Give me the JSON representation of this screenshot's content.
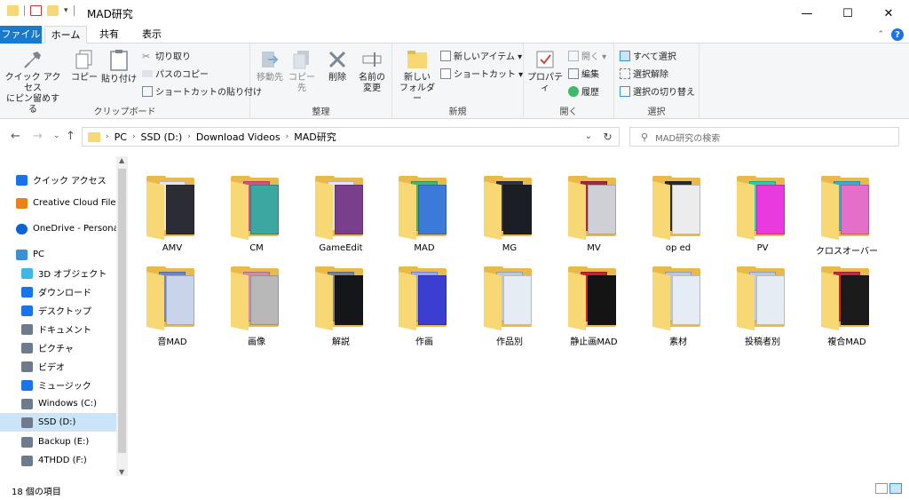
{
  "window": {
    "title": "MAD研究",
    "minimize": "—",
    "maximize": "☐",
    "close": "✕"
  },
  "ribbon_tabs": {
    "file": "ファイル",
    "home": "ホーム",
    "share": "共有",
    "view": "表示"
  },
  "ribbon": {
    "clipboard": {
      "label": "クリップボード",
      "pin": "クイック アクセス\nにピン留めする",
      "copy": "コピー",
      "paste": "貼り付け",
      "cut": "切り取り",
      "copy_path": "パスのコピー",
      "paste_shortcut": "ショートカットの貼り付け"
    },
    "organize": {
      "label": "整理",
      "move_to": "移動先",
      "copy_to": "コピー先",
      "delete": "削除",
      "rename": "名前の\n変更"
    },
    "new": {
      "label": "新規",
      "new_folder": "新しい\nフォルダー",
      "new_item": "新しいアイテム ▾",
      "shortcut": "ショートカット ▾"
    },
    "open": {
      "label": "開く",
      "properties": "プロパティ",
      "open": "開く ▾",
      "edit": "編集",
      "history": "履歴"
    },
    "select": {
      "label": "選択",
      "select_all": "すべて選択",
      "select_none": "選択解除",
      "invert": "選択の切り替え"
    }
  },
  "address": {
    "crumbs": [
      "PC",
      "SSD (D:)",
      "Download Videos",
      "MAD研究"
    ],
    "search_placeholder": "MAD研究の検索"
  },
  "nav": {
    "items": [
      {
        "label": "クイック アクセス",
        "icon": "star-icon",
        "color": "#1a73e8"
      },
      {
        "label": "Creative Cloud Files",
        "icon": "creative-cloud-icon",
        "color": "#e8831a"
      },
      {
        "label": "OneDrive - Persona",
        "icon": "cloud-icon",
        "color": "#0a64d1"
      },
      {
        "label": "PC",
        "icon": "pc-icon",
        "color": "#3d8fd6"
      },
      {
        "label": "3D オブジェクト",
        "icon": "cube-icon",
        "color": "#3fb6e8"
      },
      {
        "label": "ダウンロード",
        "icon": "download-icon",
        "color": "#1a73e8"
      },
      {
        "label": "デスクトップ",
        "icon": "desktop-icon",
        "color": "#1a73e8"
      },
      {
        "label": "ドキュメント",
        "icon": "document-icon",
        "color": "#6d7b8d"
      },
      {
        "label": "ピクチャ",
        "icon": "picture-icon",
        "color": "#6d7b8d"
      },
      {
        "label": "ビデオ",
        "icon": "video-icon",
        "color": "#6d7b8d"
      },
      {
        "label": "ミュージック",
        "icon": "music-icon",
        "color": "#1a73e8"
      },
      {
        "label": "Windows (C:)",
        "icon": "windows-drive-icon",
        "color": "#6d7b8d"
      },
      {
        "label": "SSD (D:)",
        "icon": "drive-icon",
        "color": "#6d7b8d"
      },
      {
        "label": "Backup (E:)",
        "icon": "drive-icon",
        "color": "#6d7b8d"
      },
      {
        "label": "4THDD (F:)",
        "icon": "drive-icon",
        "color": "#6d7b8d"
      }
    ]
  },
  "folders": [
    {
      "name": "AMV",
      "colors": [
        "#2c2c34",
        "#e6e6ea"
      ]
    },
    {
      "name": "CM",
      "colors": [
        "#3ca6a0",
        "#d94f7a"
      ]
    },
    {
      "name": "GameEdit",
      "colors": [
        "#7a3f8c",
        "#e8e4f0"
      ]
    },
    {
      "name": "MAD",
      "colors": [
        "#3b7ad9",
        "#3fb86a"
      ]
    },
    {
      "name": "MG",
      "colors": [
        "#1b1e24",
        "#2c3442"
      ]
    },
    {
      "name": "MV",
      "colors": [
        "#cfcfd6",
        "#a42a38"
      ]
    },
    {
      "name": "op ed",
      "colors": [
        "#ececec",
        "#2a2a2a"
      ]
    },
    {
      "name": "PV",
      "colors": [
        "#e83adf",
        "#1fd6a0"
      ]
    },
    {
      "name": "クロスオーバー",
      "colors": [
        "#e36fc8",
        "#2fb1d1"
      ]
    },
    {
      "name": "音MAD",
      "colors": [
        "#c9d3ea",
        "#6a85c8"
      ]
    },
    {
      "name": "画像",
      "colors": [
        "#b8b8b8",
        "#d78aa1"
      ]
    },
    {
      "name": "解説",
      "colors": [
        "#14161a",
        "#7b8190"
      ]
    },
    {
      "name": "作画",
      "colors": [
        "#3a3fd1",
        "#9ca6f2"
      ]
    },
    {
      "name": "作品別",
      "colors": [
        "#e6ecf4",
        "#bcc8d8"
      ]
    },
    {
      "name": "静止画MAD",
      "colors": [
        "#141414",
        "#c92424"
      ]
    },
    {
      "name": "素材",
      "colors": [
        "#e6ecf4",
        "#bcc8d8"
      ]
    },
    {
      "name": "投稿者別",
      "colors": [
        "#e6ecf4",
        "#bcc8d8"
      ]
    },
    {
      "name": "複合MAD",
      "colors": [
        "#1b1b1b",
        "#c42b3a"
      ]
    }
  ],
  "status": {
    "count": "18 個の項目"
  }
}
